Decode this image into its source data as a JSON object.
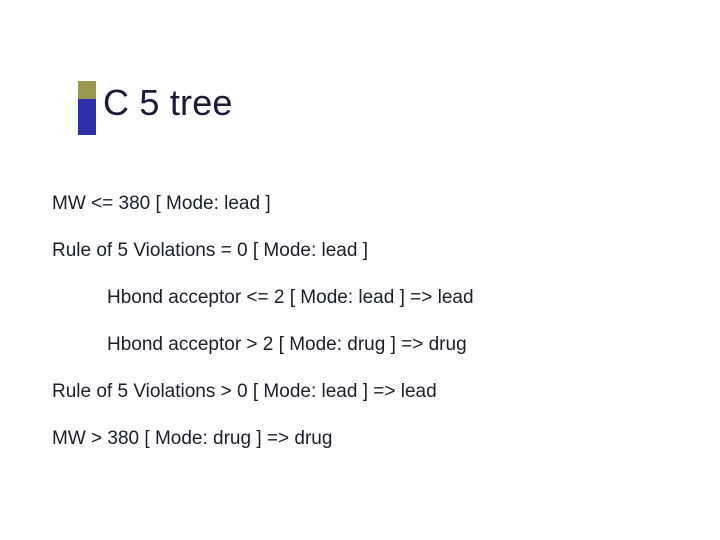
{
  "title": "C 5 tree",
  "lines": [
    {
      "text": "MW <= 380 [ Mode: lead ]",
      "indent": 0
    },
    {
      "text": "Rule of 5 Violations = 0 [ Mode: lead ]",
      "indent": 0
    },
    {
      "text": "Hbond acceptor <= 2 [ Mode: lead ] => lead",
      "indent": 1
    },
    {
      "text": "Hbond acceptor > 2 [ Mode: drug ] => drug",
      "indent": 1
    },
    {
      "text": "Rule of 5 Violations > 0 [ Mode: lead ] => lead",
      "indent": 0
    },
    {
      "text": "MW > 380 [ Mode: drug ] => drug",
      "indent": 0
    }
  ]
}
